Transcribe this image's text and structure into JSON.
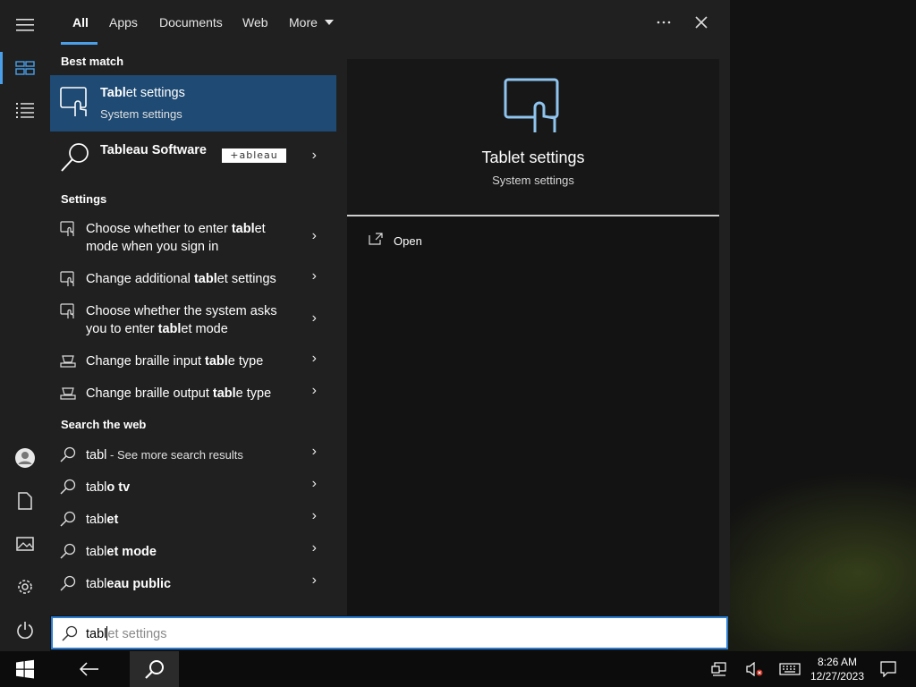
{
  "tabs": {
    "all": "All",
    "apps": "Apps",
    "documents": "Documents",
    "web": "Web",
    "more": "More"
  },
  "best_match": {
    "header": "Best match",
    "title_bold": "Tabl",
    "title_rest": "et settings",
    "subtitle": "System settings"
  },
  "tableau": {
    "title_bold": "Tabl",
    "title_rest": "eau Software",
    "logo_text": "+ableau"
  },
  "settings": {
    "header": "Settings",
    "items": [
      {
        "a": "Choose whether to enter ",
        "b": "tabl",
        "c": "et",
        "line2": "mode when you sign in"
      },
      {
        "a": "Change additional ",
        "b": "tabl",
        "c": "et settings"
      },
      {
        "a": "Choose whether the system asks",
        "line2a": "you to enter ",
        "line2b": "tabl",
        "line2c": "et mode"
      },
      {
        "a": "Change braille input ",
        "b": "tabl",
        "c": "e type"
      },
      {
        "a": "Change braille output ",
        "b": "tabl",
        "c": "e type"
      }
    ]
  },
  "web": {
    "header": "Search the web",
    "first_query": "tabl",
    "first_suffix": " - See more search results",
    "items": [
      {
        "pre": "tabl",
        "bold": "o tv"
      },
      {
        "pre": "tabl",
        "bold": "et"
      },
      {
        "pre": "tabl",
        "bold": "et mode"
      },
      {
        "pre": "tabl",
        "bold": "eau public"
      }
    ]
  },
  "detail": {
    "title": "Tablet settings",
    "subtitle": "System settings",
    "open_label": "Open"
  },
  "search": {
    "typed": "tabl",
    "suggestion": "et settings"
  },
  "clock": {
    "time": "8:26 AM",
    "date": "12/27/2023"
  },
  "colors": {
    "accent": "#4a9fe8",
    "selected_row": "#1e4a73",
    "panel": "#202020"
  }
}
